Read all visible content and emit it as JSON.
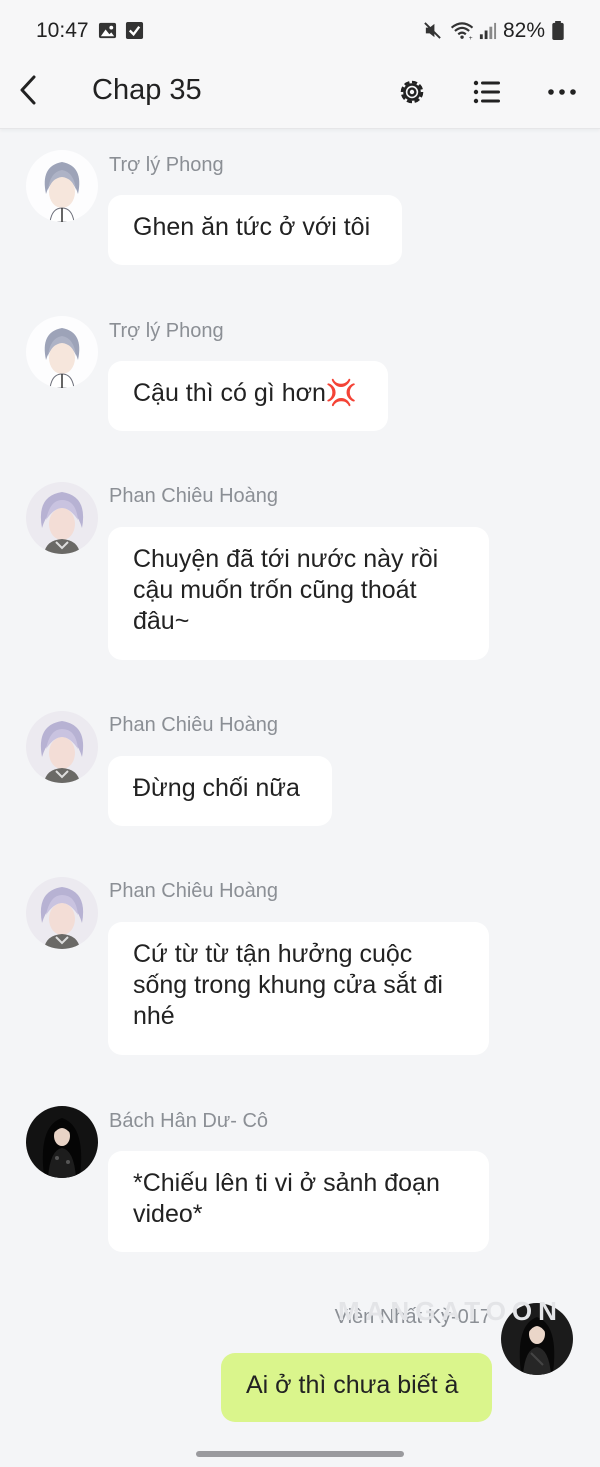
{
  "status_bar": {
    "time": "10:47",
    "battery": "82%"
  },
  "header": {
    "title": "Chap 35"
  },
  "watermark": "MANGATOON",
  "messages": [
    {
      "sender": "Trợ lý Phong",
      "text": "Ghen ăn tức ở với tôi"
    },
    {
      "sender": "Trợ lý Phong",
      "text": "Cậu thì có gì hơn💢"
    },
    {
      "sender": "Phan Chiêu Hoàng",
      "text": "Chuyện đã tới nước này rồi cậu muốn trốn cũng thoát đâu~"
    },
    {
      "sender": "Phan Chiêu Hoàng",
      "text": "Đừng chối nữa"
    },
    {
      "sender": "Phan Chiêu Hoàng",
      "text": "Cứ từ từ tận hưởng cuộc sống trong khung cửa sắt đi nhé"
    },
    {
      "sender": "Bách Hân Dư- Cô",
      "text": "*Chiếu lên ti vi ở sảnh đoạn video*"
    },
    {
      "sender": "Viên Nhất Kỳ-017",
      "text": "Ai ở thì chưa biết à"
    }
  ],
  "icons": {
    "back": "back-arrow-icon",
    "settings": "gear-icon",
    "list": "list-icon",
    "more": "more-dots-icon",
    "gallery": "image-icon",
    "check": "checkbox-icon",
    "mute": "mute-icon",
    "wifi": "wifi-icon",
    "signal": "signal-icon",
    "battery": "battery-icon"
  },
  "colors": {
    "background": "#f4f5f7",
    "bubble_other": "#ffffff",
    "bubble_mine": "#daf58c",
    "sender_name": "#8b8f95"
  }
}
